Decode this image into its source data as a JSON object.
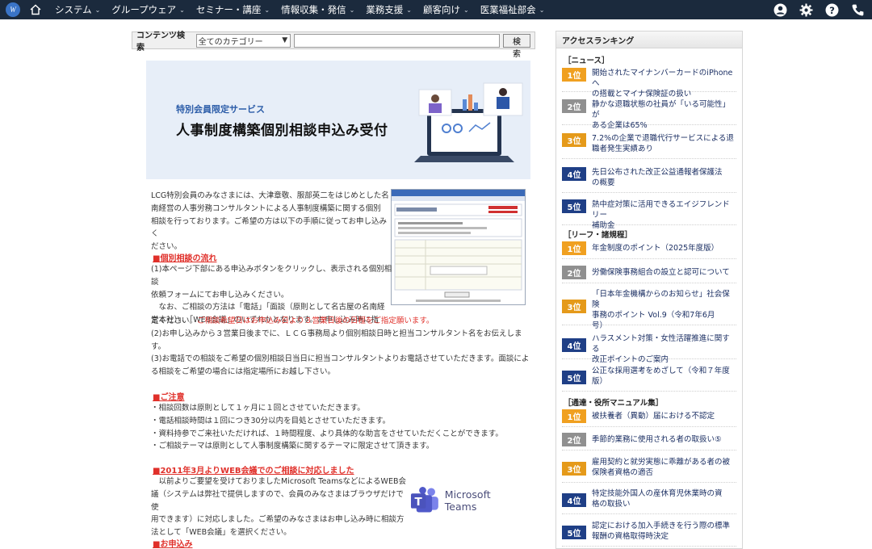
{
  "nav": {
    "logo_text": "W",
    "items": [
      {
        "label": "システム"
      },
      {
        "label": "グループウェア"
      },
      {
        "label": "セミナー・講座"
      },
      {
        "label": "情報収集・発信"
      },
      {
        "label": "業務支援"
      },
      {
        "label": "顧客向け"
      },
      {
        "label": "医業福祉部会"
      }
    ],
    "icons": [
      "home-icon",
      "user-icon",
      "gear-icon",
      "help-icon",
      "phone-icon"
    ]
  },
  "search": {
    "label": "コンテンツ検索",
    "category": "全てのカテゴリー",
    "button": "検索"
  },
  "banner": {
    "subtitle": "特別会員限定サービス",
    "title": "人事制度構築個別相談申込み受付"
  },
  "body": {
    "intro": [
      "LCG特別会員のみなさまには、大津章敬、服部英二をはじめとした名",
      "南経営の人事労務コンサルタントによる人事制度構築に関する個別",
      "相談を行っております。ご希望の方は以下の手順に従ってお申し込みく",
      "ださい。"
    ],
    "flow_head": "■個別相談の流れ",
    "flow": [
      "(1)本ページ下部にある申込みボタンをクリックし、表示される個別相談",
      "依頼フォームにてお申し込みください。",
      "　なお、ご相談の方法は「電話」「面談（原則として名古屋の名南経",
      "営本社）」、「WEB会議」のいずれかとなります。お申し込み時に指",
      "定ください。"
    ],
    "flow_red": "ご相談希望日はお申込み日より３営業日後の日程をご指定願います。",
    "flow2": [
      "(2)お申し込みから３営業日後までに、ＬＣＧ事務局より個別相談日時と担当コンサルタント名をお伝えしま",
      "す。",
      "(3)お電話での相談をご希望の個別相談日当日に担当コンサルタントよりお電話させていただきます。面談によ",
      "る相談をご希望の場合には指定場所にお越し下さい。"
    ],
    "note_head": "■ご注意",
    "notes": [
      "・相談回数は原則として１ヶ月に１回とさせていただきます。",
      "・電話相談時間は１回につき30分以内を目処とさせていただきます。",
      "・資料持参でご来社いただければ、１時間程度、より具体的な助言をさせていただくことができます。",
      "・ご相談テーマは原則として人事制度構築に関するテーマに限定させて頂きます。"
    ],
    "web_head": "■2011年3月よりWEB会議でのご相談に対応しました",
    "web": [
      "　以前よりご要望を受けておりましたMicrosoft TeamsなどによるWEB会",
      "議（システムは弊社で提供しますので、会員のみなさまはブラウザだけで使",
      "用できます）に対応しました。ご希望のみなさまはお申し込み時に相談方",
      "法として「WEB会議」を選択ください。"
    ],
    "apply_head": "■お申込み",
    "teams_label": "Microsoft Teams"
  },
  "sidebar": {
    "title": "アクセスランキング",
    "categories": [
      {
        "name": "［ニュース］",
        "items": [
          {
            "rank": "1位",
            "text": [
              "開始されたマイナンバーカードのiPhoneへ",
              "の搭載とマイナ保険証の扱い"
            ]
          },
          {
            "rank": "2位",
            "text": [
              "静かな退職状態の社員が「いる可能性」が",
              "ある企業は65%"
            ]
          },
          {
            "rank": "3位",
            "text": [
              "7.2%の企業で退職代行サービスによる退",
              "職者発生実績あり"
            ]
          },
          {
            "rank": "4位",
            "text": [
              "先日公布された改正公益通報者保護法",
              "の概要"
            ]
          },
          {
            "rank": "5位",
            "text": [
              "熱中症対策に活用できるエイジフレンドリー",
              "補助金"
            ]
          }
        ]
      },
      {
        "name": "［リーフ・諸規程］",
        "items": [
          {
            "rank": "1位",
            "text": [
              "年金制度のポイント（2025年度版）"
            ]
          },
          {
            "rank": "2位",
            "text": [
              "労働保険事務組合の設立と認可について"
            ]
          },
          {
            "rank": "3位",
            "text": [
              "「日本年金機構からのお知らせ」社会保険",
              "事務のポイント Vol.9（令和7年6月",
              "号）"
            ]
          },
          {
            "rank": "4位",
            "text": [
              "ハラスメント対策・女性活躍推進に関する",
              "改正ポイントのご案内"
            ]
          },
          {
            "rank": "5位",
            "text": [
              "公正な採用選考をめざして（令和７年度",
              "版）"
            ]
          }
        ]
      },
      {
        "name": "［通達・役所マニュアル集］",
        "items": [
          {
            "rank": "1位",
            "text": [
              "被扶養者（異動）届における不認定"
            ]
          },
          {
            "rank": "2位",
            "text": [
              "季節的業務に使用される者の取扱い⑤"
            ]
          },
          {
            "rank": "3位",
            "text": [
              "雇用契約と就労実態に乖離がある者の被",
              "保険者資格の適否"
            ]
          },
          {
            "rank": "4位",
            "text": [
              "特定技能外国人の産休育児休業時の資",
              "格の取扱い"
            ]
          },
          {
            "rank": "5位",
            "text": [
              "認定における加入手続きを行う際の標準",
              "報酬の資格取得時決定"
            ]
          }
        ]
      }
    ]
  }
}
